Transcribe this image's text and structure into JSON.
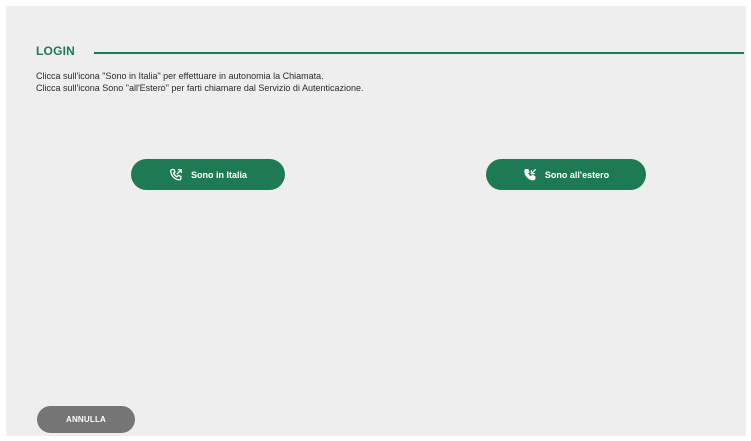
{
  "header": {
    "title": "LOGIN"
  },
  "instructions": {
    "line1": "Clicca sull'icona \"Sono in Italia\" per effettuare in autonomia la Chiamata.",
    "line2": "Clicca sull'icona Sono \"all'Estero\" per farti chiamare dal Servizio di Autenticazione."
  },
  "options": {
    "italia_label": "Sono in Italia",
    "italia_icon": "phone-outgoing-icon",
    "estero_label": "Sono all'estero",
    "estero_icon": "phone-incoming-icon"
  },
  "footer": {
    "cancel_label": "ANNULLA"
  },
  "colors": {
    "accent": "#1e7a52",
    "cancel": "#757575",
    "background": "#eeeeef"
  }
}
